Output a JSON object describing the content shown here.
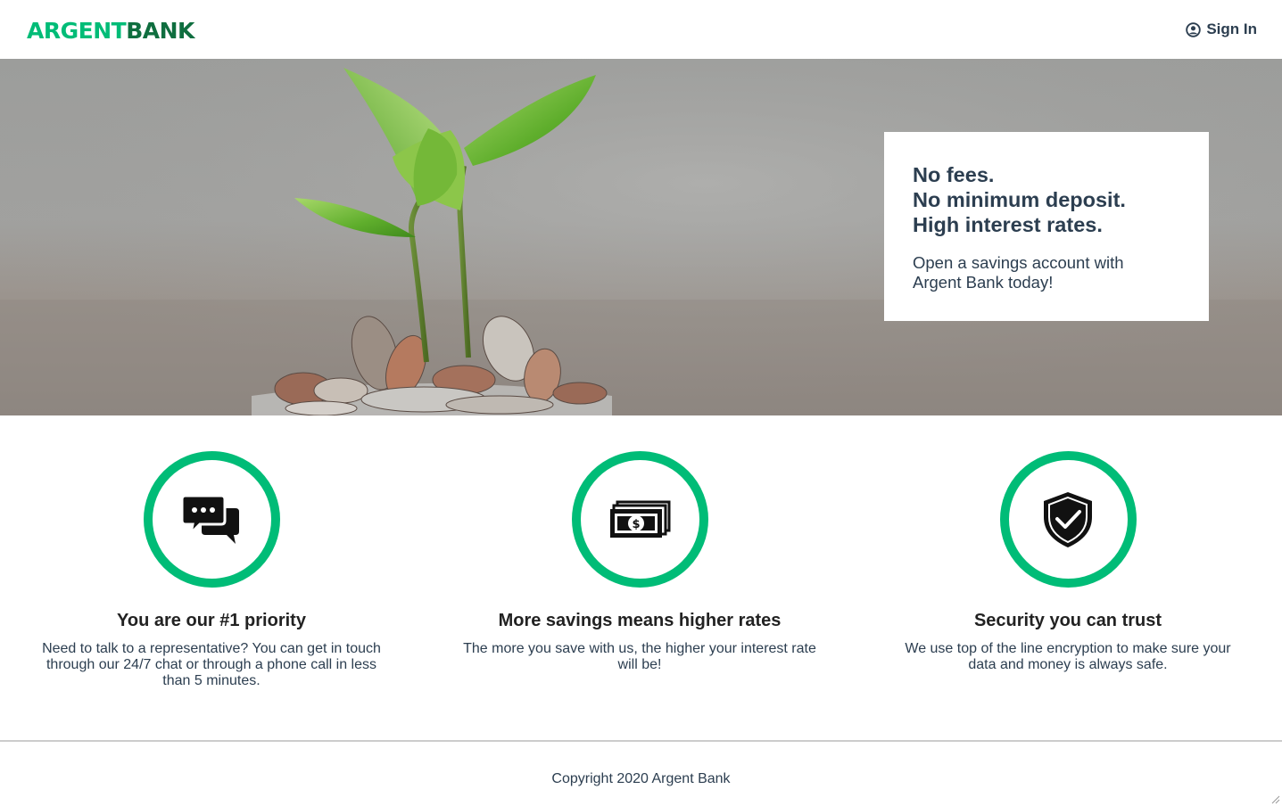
{
  "header": {
    "logo_part1": "ARGENT",
    "logo_part2": "BANK",
    "sign_in_label": "Sign In"
  },
  "hero": {
    "subtitles": [
      "No fees.",
      "No minimum deposit.",
      "High interest rates."
    ],
    "text": "Open a savings account with Argent Bank today!"
  },
  "features": [
    {
      "icon": "chat-icon",
      "title": "You are our #1 priority",
      "text": "Need to talk to a representative? You can get in touch through our 24/7 chat or through a phone call in less than 5 minutes."
    },
    {
      "icon": "money-icon",
      "title": "More savings means higher rates",
      "text": "The more you save with us, the higher your interest rate will be!"
    },
    {
      "icon": "security-icon",
      "title": "Security you can trust",
      "text": "We use top of the line encryption to make sure your data and money is always safe."
    }
  ],
  "footer": {
    "copyright": "Copyright 2020 Argent Bank"
  },
  "colors": {
    "brand_green": "#00bc77",
    "brand_dark_green": "#0f6e3f",
    "text_dark": "#2c3e50"
  }
}
